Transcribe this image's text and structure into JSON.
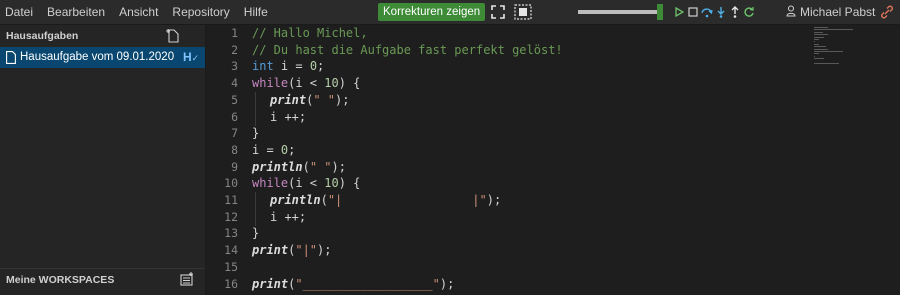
{
  "menu": {
    "items": [
      "Datei",
      "Bearbeiten",
      "Ansicht",
      "Repository",
      "Hilfe"
    ]
  },
  "toolbar": {
    "corrections_label": "Korrekturen zeigen",
    "icons": [
      "fullscreen-icon",
      "screen-capture-icon",
      "play-icon",
      "stop-icon",
      "step-over-icon",
      "step-into-icon",
      "step-out-icon",
      "restart-icon"
    ],
    "slider_fraction": 0.94,
    "accent_color": "#3d8b37"
  },
  "user": {
    "name": "Michael Pabst"
  },
  "sidebar": {
    "title": "Hausaufgaben",
    "task": {
      "label": "Hausaufgabe vom 09.01.2020",
      "mark": "H"
    },
    "workspaces_title": "Meine WORKSPACES"
  },
  "editor": {
    "lines": [
      {
        "n": "1",
        "text": "// Hallo Michel,"
      },
      {
        "n": "2",
        "text": "// Du hast die Aufgabe fast perfekt gelöst!"
      },
      {
        "n": "3",
        "text": "int i = 0;"
      },
      {
        "n": "4",
        "text": "while(i < 10) {"
      },
      {
        "n": "5",
        "text": "print(\" \");"
      },
      {
        "n": "6",
        "text": "i ++;"
      },
      {
        "n": "7",
        "text": "}"
      },
      {
        "n": "8",
        "text": "i = 0;"
      },
      {
        "n": "9",
        "text": "println(\" \");"
      },
      {
        "n": "10",
        "text": "while(i < 10) {"
      },
      {
        "n": "11",
        "text": "println(\"|                  |\");"
      },
      {
        "n": "12",
        "text": "i ++;"
      },
      {
        "n": "13",
        "text": "}"
      },
      {
        "n": "14",
        "text": "print(\"|\");"
      },
      {
        "n": "15",
        "text": ""
      },
      {
        "n": "16",
        "text": "print(\"__________________\");"
      }
    ]
  }
}
